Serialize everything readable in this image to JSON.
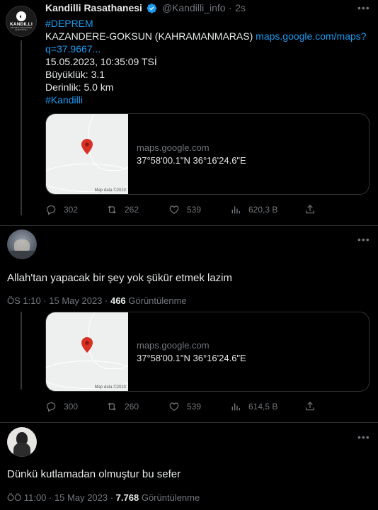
{
  "main_tweet": {
    "author_name": "Kandilli Rasathanesi",
    "handle": "@Kandilli_info",
    "separator": "·",
    "time_ago": "2s",
    "avatar_logo_text": "KANDILLI",
    "avatar_logo_sub": "DEPREM ARAŞTIRMA ENSTİTÜSÜ",
    "hashtag_deprem": "#DEPREM",
    "location_text": "KAZANDERE-GOKSUN (KAHRAMANMARAS)",
    "link_part1": "maps.google.com/maps?",
    "link_part2": "q=37.9667...",
    "datetime": "15.05.2023, 10:35:09 TSİ",
    "magnitude": "Büyüklük: 3.1",
    "depth": "Derinlik: 5.0 km",
    "hashtag_kandilli": "#Kandilli",
    "card": {
      "domain": "maps.google.com",
      "title": "37°58'00.1\"N 36°16'24.6\"E",
      "map_credit": "Map data ©2023"
    },
    "actions": {
      "replies": "302",
      "retweets": "262",
      "likes": "539",
      "views": "620,3 B"
    }
  },
  "reply1": {
    "text": "Allah'tan yapacak bir şey yok şükür etmek lazim",
    "timestamp": "ÖS 1:10 · 15 May 2023 · ",
    "views_count": "466",
    "views_label": " Görüntülenme",
    "card": {
      "domain": "maps.google.com",
      "title": "37°58'00.1\"N 36°16'24.6\"E",
      "map_credit": "Map data ©2023"
    },
    "actions": {
      "replies": "300",
      "retweets": "260",
      "likes": "539",
      "views": "614,5 B"
    }
  },
  "reply2": {
    "text": "Dünkü kutlamadan olmuştur bu sefer",
    "timestamp": "ÖÖ 11:00 · 15 May 2023 · ",
    "views_count": "7.768",
    "views_label": " Görüntülenme"
  },
  "colors": {
    "accent": "#1d9bf0",
    "background": "#000000",
    "muted": "#71767b",
    "text": "#e7e9ea"
  },
  "icons": [
    "verified-badge-icon",
    "more-icon",
    "reply-icon",
    "retweet-icon",
    "like-icon",
    "views-icon",
    "share-icon",
    "map-pin-icon"
  ]
}
